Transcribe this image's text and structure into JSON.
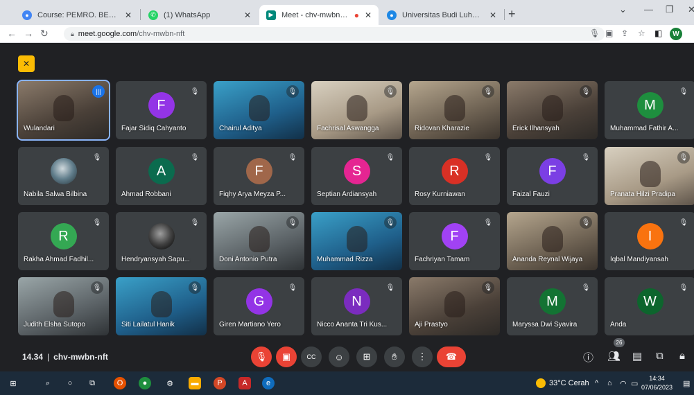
{
  "browser": {
    "tabs": [
      {
        "title": "Course: PEMRO. BEROR. OBYEK-",
        "favicon_color": "#4285f4",
        "active": false
      },
      {
        "title": "(1) WhatsApp",
        "favicon_color": "#25d366",
        "active": false
      },
      {
        "title": "Meet - chv-mwbn-nft",
        "favicon_color": "#00897b",
        "active": true
      },
      {
        "title": "Universitas Budi Luhur - Lecture",
        "favicon_color": "#1e88e5",
        "active": false
      }
    ],
    "url_host": "meet.google.com",
    "url_path": "/chv-mwbn-nft",
    "profile_initial": "W"
  },
  "meet": {
    "participants": [
      {
        "name": "Wulandari",
        "type": "video",
        "speaking": true
      },
      {
        "name": "Fajar Sidiq Cahyanto",
        "type": "avatar",
        "initial": "F",
        "color": "#9334e6"
      },
      {
        "name": "Chairul Aditya",
        "type": "video"
      },
      {
        "name": "Fachrisal Aswangga",
        "type": "video"
      },
      {
        "name": "Ridovan Kharazie",
        "type": "video"
      },
      {
        "name": "Erick Ilhansyah",
        "type": "video"
      },
      {
        "name": "Muhammad Fathir A...",
        "type": "avatar",
        "initial": "M",
        "color": "#1e8e3e"
      },
      {
        "name": "Nabila Salwa Bilbina",
        "type": "photo-avatar"
      },
      {
        "name": "Ahmad Robbani",
        "type": "avatar",
        "initial": "A",
        "color": "#0b6b4e"
      },
      {
        "name": "Fiqhy Arya Meyza P...",
        "type": "avatar",
        "initial": "F",
        "color": "#a0674a"
      },
      {
        "name": "Septian Ardiansyah",
        "type": "avatar",
        "initial": "S",
        "color": "#e52592"
      },
      {
        "name": "Rosy Kurniawan",
        "type": "avatar",
        "initial": "R",
        "color": "#d93025"
      },
      {
        "name": "Faizal Fauzi",
        "type": "avatar",
        "initial": "F",
        "color": "#7b3fe4"
      },
      {
        "name": "Pranata Hilzi Pradipa",
        "type": "video"
      },
      {
        "name": "Rakha Ahmad Fadhil...",
        "type": "avatar",
        "initial": "R",
        "color": "#34a853"
      },
      {
        "name": "Hendryansyah Sapu...",
        "type": "dark-avatar"
      },
      {
        "name": "Doni Antonio Putra",
        "type": "video"
      },
      {
        "name": "Muhammad Rizza",
        "type": "video"
      },
      {
        "name": "Fachriyan Tamam",
        "type": "avatar",
        "initial": "F",
        "color": "#a142f4"
      },
      {
        "name": "Ananda Reynal Wijaya",
        "type": "video"
      },
      {
        "name": "Iqbal Mandiyansah",
        "type": "avatar",
        "initial": "I",
        "color": "#f9730f"
      },
      {
        "name": "Judith Elsha Sutopo",
        "type": "video"
      },
      {
        "name": "Siti Lailatul Hanik",
        "type": "video"
      },
      {
        "name": "Giren Martiano Yero",
        "type": "avatar",
        "initial": "G",
        "color": "#9334e6"
      },
      {
        "name": "Nicco Ananta Tri Kus...",
        "type": "avatar",
        "initial": "N",
        "color": "#7b2cbf"
      },
      {
        "name": "Aji Prastyo",
        "type": "video"
      },
      {
        "name": "Maryssa Dwi Syavira",
        "type": "avatar",
        "initial": "M",
        "color": "#137333"
      },
      {
        "name": "Anda",
        "type": "avatar",
        "initial": "W",
        "color": "#0d652d"
      }
    ],
    "time": "14.34",
    "separator": "|",
    "meeting_code": "chv-mwbn-nft",
    "participant_count": "26"
  },
  "taskbar": {
    "weather": "33°C  Cerah",
    "clock_time": "14:34",
    "clock_date": "07/06/2023"
  }
}
